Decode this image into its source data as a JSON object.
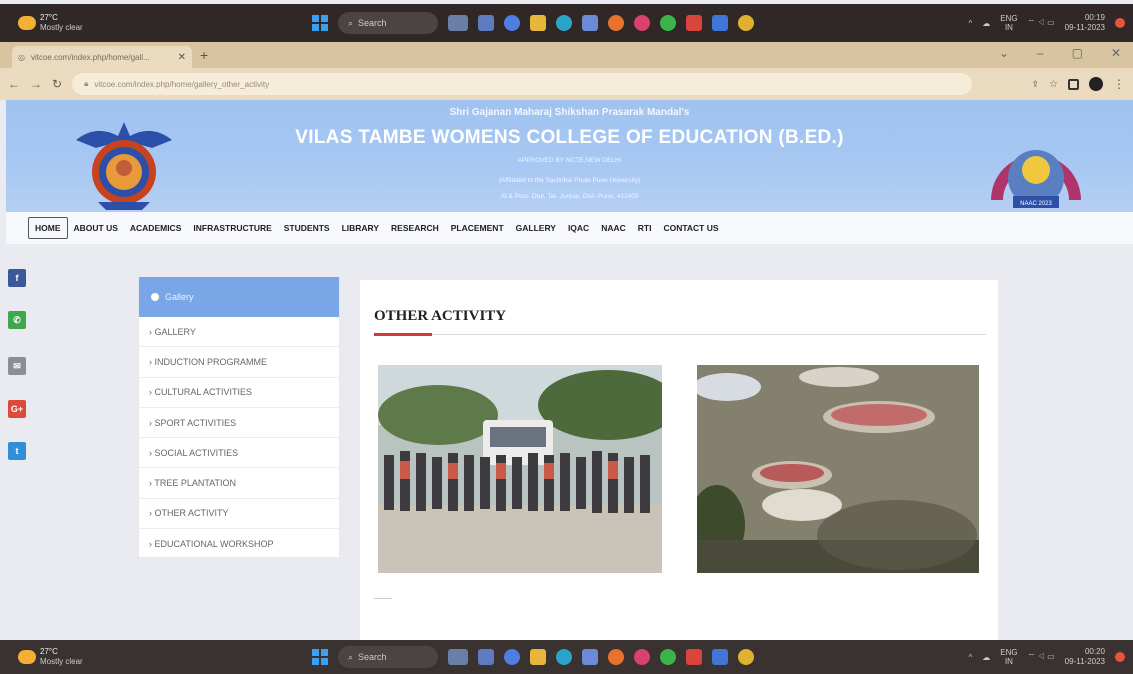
{
  "taskbar_top": {
    "weather_temp": "27°C",
    "weather_desc": "Mostly clear",
    "search_label": "Search",
    "lang": "ENG",
    "region": "IN",
    "time": "00:19",
    "date": "09-11-2023"
  },
  "taskbar_bottom": {
    "weather_temp": "27°C",
    "weather_desc": "Mostly clear",
    "search_label": "Search",
    "lang": "ENG",
    "region": "IN",
    "time": "00:20",
    "date": "09-11-2023"
  },
  "browser": {
    "tab_title": "vitcoe.com/index.php/home/gall...",
    "url": "vitcoe.com/index.php/home/gallery_other_activity"
  },
  "header": {
    "org": "Shri Gajanan Maharaj Shikshan Prasarak Mandal's",
    "college": "VILAS TAMBE WOMENS COLLEGE OF EDUCATION (B.ED.)",
    "approved": "APPROVED BY NCTE,NEW DELHI",
    "affiliated": "(Affiliated to the Savitribai Phule Pune University)",
    "address": "At & Post- Otur, Tal- Junnar, Dist- Pune, 412409",
    "seal_text": "NAAC 2023"
  },
  "nav": {
    "items": [
      "HOME",
      "ABOUT US",
      "ACADEMICS",
      "INFRASTRUCTURE",
      "STUDENTS",
      "LIBRARY",
      "RESEARCH",
      "PLACEMENT",
      "GALLERY",
      "IQAC",
      "NAAC",
      "RTI",
      "CONTACT US"
    ],
    "active_index": 0
  },
  "social": [
    {
      "icon": "facebook-icon",
      "glyph": "f",
      "color": "#3b5998"
    },
    {
      "icon": "whatsapp-icon",
      "glyph": "✆",
      "color": "#3ea84a"
    },
    {
      "icon": "email-icon",
      "glyph": "✉",
      "color": "#8a8e95"
    },
    {
      "icon": "google-plus-icon",
      "glyph": "G+",
      "color": "#dc4a38"
    },
    {
      "icon": "twitter-icon",
      "glyph": "t",
      "color": "#2f8fd8"
    }
  ],
  "sidebar": {
    "heading": "Gallery",
    "items": [
      "› GALLERY",
      "› INDUCTION PROGRAMME",
      "› CULTURAL ACTIVITIES",
      "› SPORT ACTIVITIES",
      "› SOCIAL ACTIVITIES",
      "› TREE PLANTATION",
      "› OTHER ACTIVITY",
      "› EDUCATIONAL WORKSHOP"
    ]
  },
  "content": {
    "title": "OTHER ACTIVITY"
  },
  "colors": {
    "banner": "#a8c8f3",
    "sidebar_head": "#78a6e6",
    "accent_rule": "#d23a3a"
  }
}
